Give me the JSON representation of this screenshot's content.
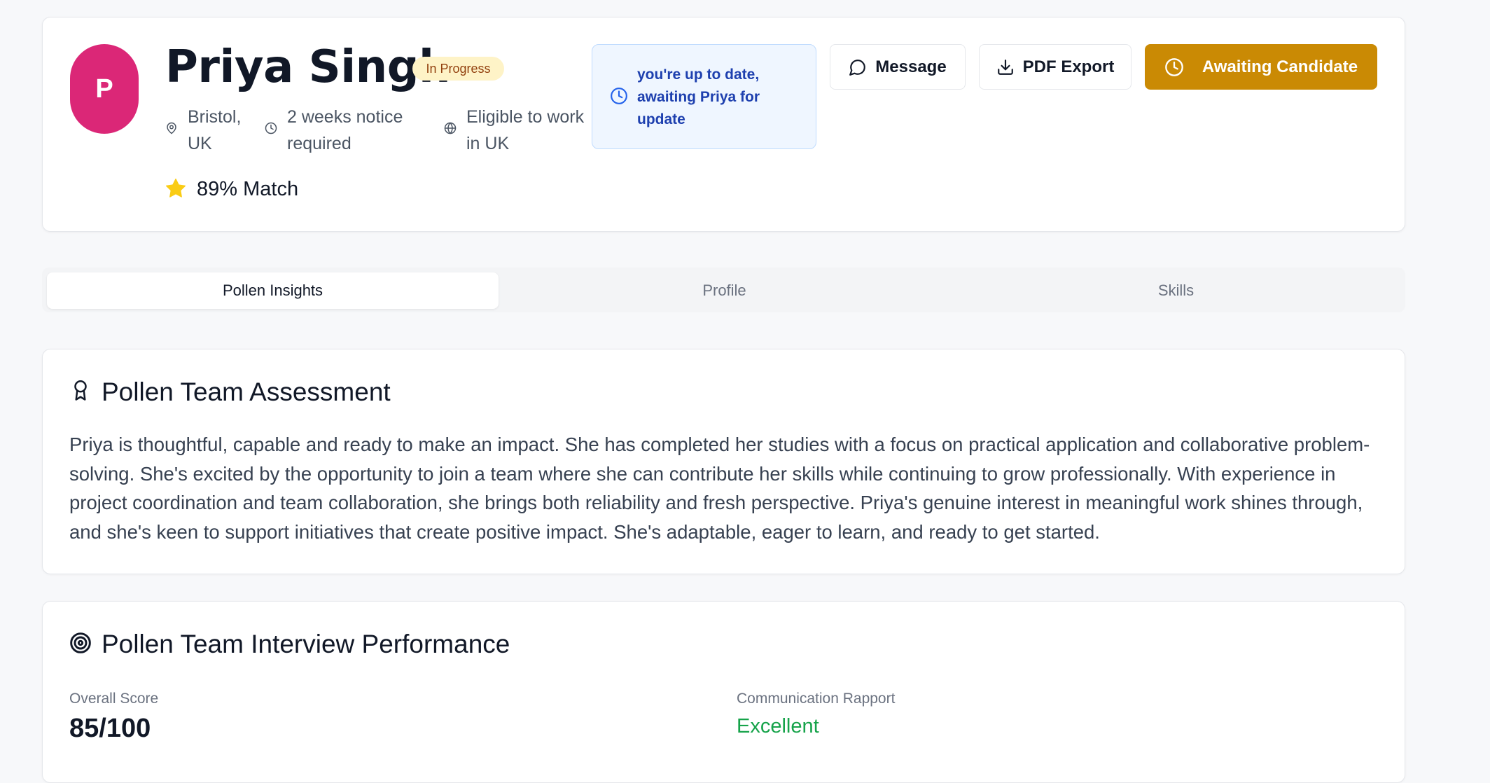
{
  "candidate": {
    "avatar_initial": "P",
    "name": "Priya Singh",
    "status": "In Progress",
    "location_line1": "Bristol,",
    "location_line2": "UK",
    "notice_line1": "2 weeks notice",
    "notice_line2": "required",
    "eligibility_line1": "Eligible to work",
    "eligibility_line2": "in UK",
    "match": "89% Match"
  },
  "notice": {
    "text": "you're up to date, awaiting Priya for update"
  },
  "actions": {
    "message_label": "Message",
    "pdf_label": "PDF Export",
    "awaiting_label": "Awaiting Candidate"
  },
  "tabs": [
    {
      "label": "Pollen Insights",
      "active": true
    },
    {
      "label": "Profile",
      "active": false
    },
    {
      "label": "Skills",
      "active": false
    }
  ],
  "assessment": {
    "title": "Pollen Team Assessment",
    "body": "Priya is thoughtful, capable and ready to make an impact. She has completed her studies with a focus on practical application and collaborative problem-solving. She's excited by the opportunity to join a team where she can contribute her skills while continuing to grow professionally. With experience in project coordination and team collaboration, she brings both reliability and fresh perspective. Priya's genuine interest in meaningful work shines through, and she's keen to support initiatives that create positive impact. She's adaptable, eager to learn, and ready to get started."
  },
  "interview": {
    "title": "Pollen Team Interview Performance",
    "overall_label": "Overall Score",
    "overall_value": "85/100",
    "communication_label": "Communication Rapport",
    "communication_value": "Excellent"
  },
  "colors": {
    "avatar": "#db2777",
    "awaiting_button": "#ca8a04",
    "notice_background": "#eff6ff",
    "notice_text": "#1e40af",
    "status_badge": "#fef3c7",
    "excellent": "#16a34a",
    "star": "#facc15"
  },
  "icons": {
    "location": "map-pin-icon",
    "notice": "clock-icon",
    "eligibility": "globe-icon",
    "match": "star-icon",
    "notice_box": "clock-icon",
    "message": "message-circle-icon",
    "pdf": "download-icon",
    "awaiting": "clock-icon",
    "assessment": "award-icon",
    "interview": "target-icon"
  }
}
